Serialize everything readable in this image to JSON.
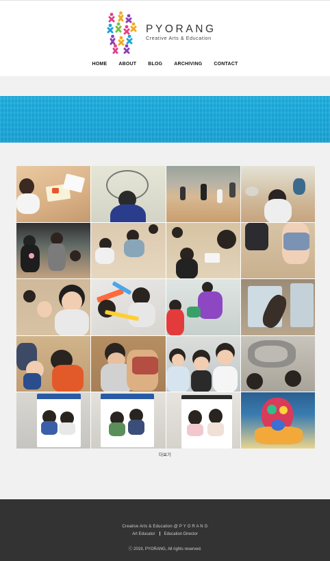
{
  "brand": {
    "name": "PYORANG",
    "tagline": "Creative Arts & Education"
  },
  "nav": {
    "items": [
      "HOME",
      "ABOUT",
      "BLOG",
      "ARCHIVING",
      "CONTACT"
    ]
  },
  "gallery": {
    "more_label": "더보기"
  },
  "footer": {
    "line1": "Creative Arts & Education @ P Y O R A N G",
    "role1": "Art Educator",
    "role2": "Education Director",
    "copyright": "ⓒ 2019, PYORANG, All rights reserved."
  }
}
